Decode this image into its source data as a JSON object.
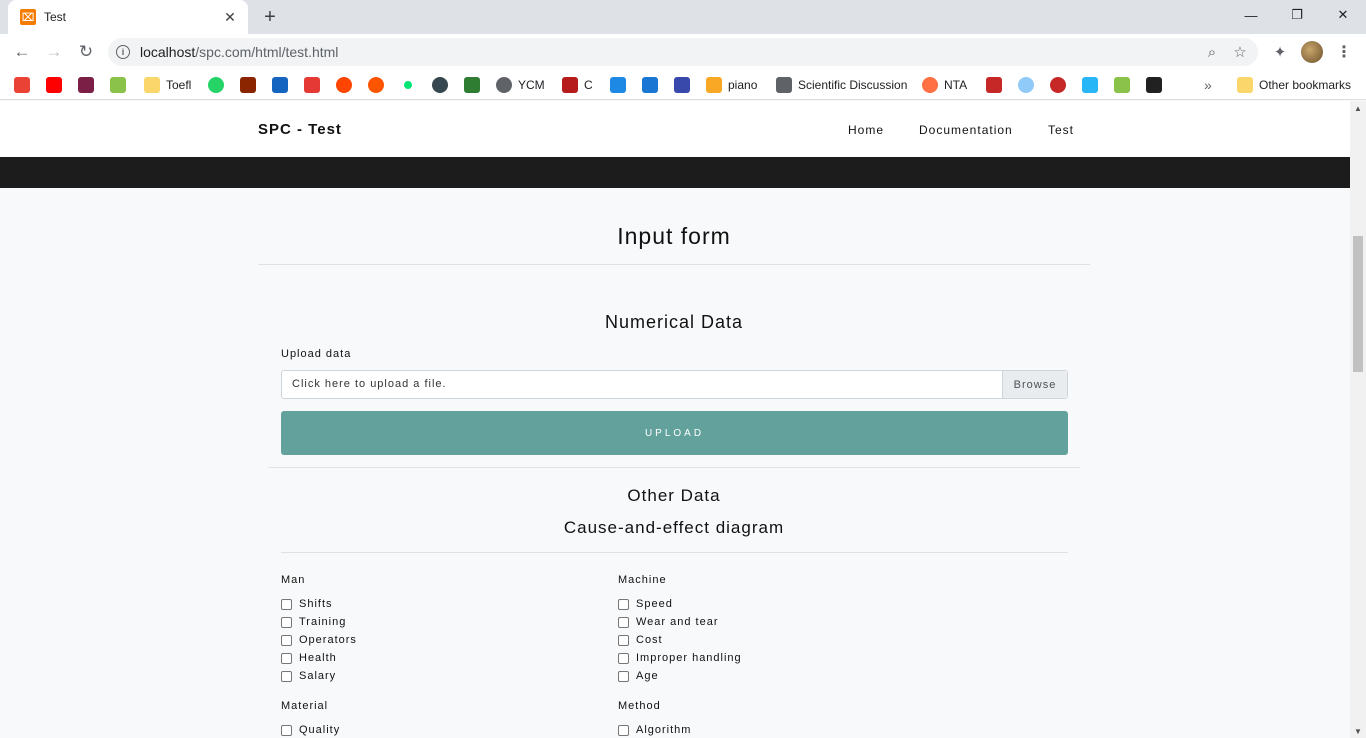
{
  "browser": {
    "tab_title": "Test",
    "url_host": "localhost",
    "url_path": "/spc.com/html/test.html",
    "bookmarks": [
      {
        "label": "",
        "icon": "gmail-icon",
        "color": "#ea4335"
      },
      {
        "label": "",
        "icon": "youtube-icon",
        "color": "#ff0000"
      },
      {
        "label": "",
        "icon": "book-icon",
        "color": "#7b1f47"
      },
      {
        "label": "",
        "icon": "download-icon",
        "color": "#8bc34a"
      },
      {
        "label": "Toefl",
        "icon": "folder-icon",
        "color": "#fbd66b"
      },
      {
        "label": "",
        "icon": "whatsapp-icon",
        "color": "#25d366"
      },
      {
        "label": "",
        "icon": "bug-icon",
        "color": "#8b2500"
      },
      {
        "label": "",
        "icon": "info-icon",
        "color": "#1565c0"
      },
      {
        "label": "",
        "icon": "uno-icon",
        "color": "#e53935"
      },
      {
        "label": "",
        "icon": "reddit-icon",
        "color": "#ff4500"
      },
      {
        "label": "",
        "icon": "soundcloud-icon",
        "color": "#ff5500"
      },
      {
        "label": "",
        "icon": "dot-icon",
        "color": "#00e676"
      },
      {
        "label": "",
        "icon": "drop-icon",
        "color": "#37474f"
      },
      {
        "label": "",
        "icon": "cube-icon",
        "color": "#2e7d32"
      },
      {
        "label": "YCM",
        "icon": "globe-icon",
        "color": "#5f6368"
      },
      {
        "label": "C",
        "icon": "cs-icon",
        "color": "#b71c1c"
      },
      {
        "label": "",
        "icon": "link-icon",
        "color": "#1e88e5"
      },
      {
        "label": "",
        "icon": "edx-icon",
        "color": "#1976d2"
      },
      {
        "label": "",
        "icon": "emblem-icon",
        "color": "#3949ab"
      },
      {
        "label": "piano",
        "icon": "music-icon",
        "color": "#f9a825"
      },
      {
        "label": "Scientific Discussion",
        "icon": "broadcast-icon",
        "color": "#5f6368"
      },
      {
        "label": "NTA",
        "icon": "check-icon",
        "color": "#ff7043"
      },
      {
        "label": "",
        "icon": "n-icon",
        "color": "#c62828"
      },
      {
        "label": "",
        "icon": "chart-icon",
        "color": "#90caf9"
      },
      {
        "label": "",
        "icon": "eye-icon",
        "color": "#c62828"
      },
      {
        "label": "",
        "icon": "water-icon",
        "color": "#29b6f6"
      },
      {
        "label": "",
        "icon": "yts-icon",
        "color": "#8bc34a"
      },
      {
        "label": "",
        "icon": "bus-icon",
        "color": "#212121"
      }
    ],
    "overflow": "»",
    "other_bookmarks": "Other bookmarks"
  },
  "nav": {
    "brand": "SPC - Test",
    "links": [
      "Home",
      "Documentation",
      "Test"
    ]
  },
  "form": {
    "title": "Input form",
    "numerical_heading": "Numerical Data",
    "upload_label": "Upload data",
    "file_placeholder": "Click here to upload a file.",
    "browse": "Browse",
    "upload_button": "UPLOAD",
    "other_heading": "Other Data",
    "cause_heading": "Cause-and-effect diagram"
  },
  "groups": [
    {
      "title": "Man",
      "items": [
        "Shifts",
        "Training",
        "Operators",
        "Health",
        "Salary"
      ]
    },
    {
      "title": "Machine",
      "items": [
        "Speed",
        "Wear and tear",
        "Cost",
        "Improper handling",
        "Age"
      ]
    },
    {
      "title": "Material",
      "items": [
        "Quality"
      ]
    },
    {
      "title": "Method",
      "items": [
        "Algorithm"
      ]
    }
  ],
  "colors": {
    "accent": "#63a19c",
    "dark_band": "#1c1c1c"
  }
}
